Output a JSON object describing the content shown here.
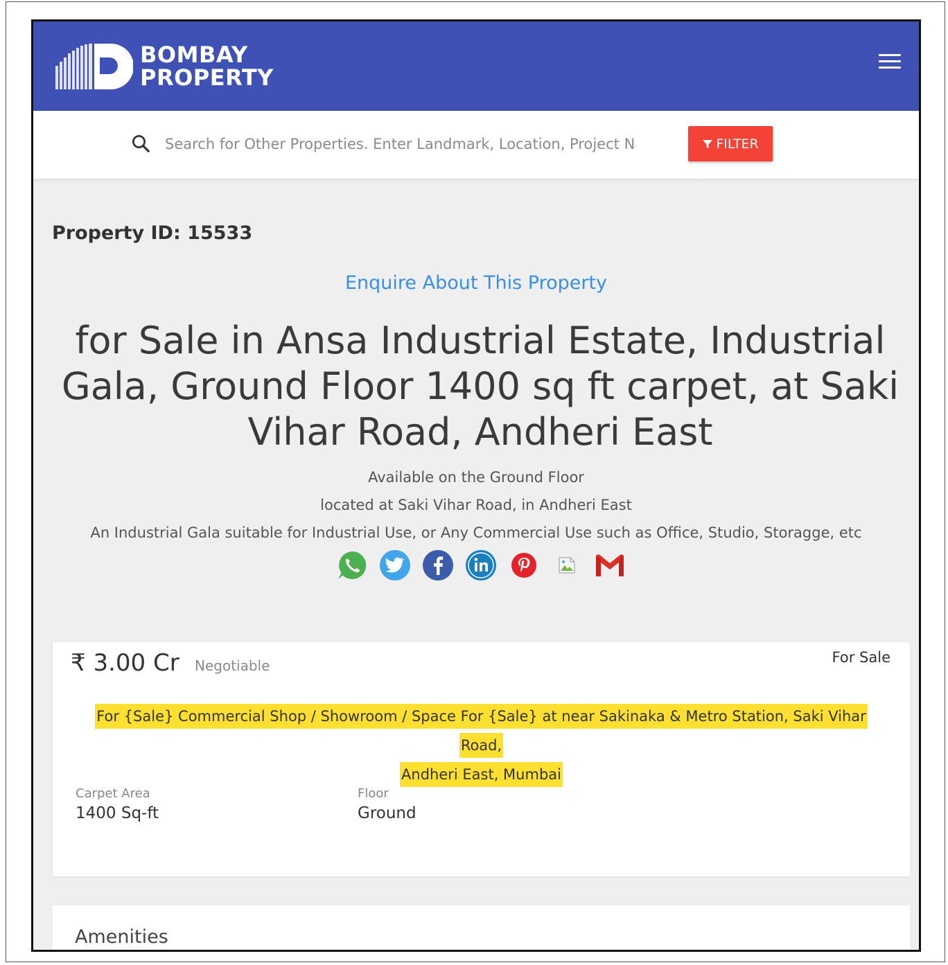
{
  "header": {
    "brand_line1": "BOMBAY",
    "brand_line2": "PROPERTY",
    "menu_icon": "hamburger-menu-icon",
    "background_color": "#3f51b5"
  },
  "search": {
    "placeholder": "Search for Other Properties. Enter Landmark, Location, Project Name",
    "icon": "search-icon",
    "filter_label": "FILTER",
    "filter_color": "#f44336"
  },
  "property": {
    "id_label": "Property ID: 15533",
    "enquire_label": "Enquire About This Property",
    "title": "for Sale in Ansa Industrial Estate, Industrial Gala, Ground Floor 1400 sq ft carpet, at Saki Vihar Road, Andheri East",
    "description_lines": [
      "Available on the Ground Floor",
      "located at Saki Vihar Road, in Andheri East",
      "An Industrial Gala suitable for Industrial Use, or Any Commercial Use such as Office, Studio, Storagge, etc"
    ],
    "share_icons": [
      "whatsapp-icon",
      "twitter-icon",
      "facebook-icon",
      "linkedin-icon",
      "pinterest-icon",
      "broken-image-icon",
      "gmail-icon"
    ]
  },
  "price_card": {
    "price": "₹ 3.00 Cr",
    "negotiable": "Negotiable",
    "status": "For Sale",
    "headline_line1": "For {Sale} Commercial Shop / Showroom / Space For {Sale} at near Sakinaka & Metro Station, Saki Vihar Road,",
    "headline_line2": "Andheri East, Mumbai",
    "highlight_color": "#ffe030",
    "specs": {
      "carpet_label": "Carpet Area",
      "carpet_value": "1400 Sq-ft",
      "floor_label": "Floor",
      "floor_value": "Ground"
    }
  },
  "amenities": {
    "title": "Amenities"
  }
}
